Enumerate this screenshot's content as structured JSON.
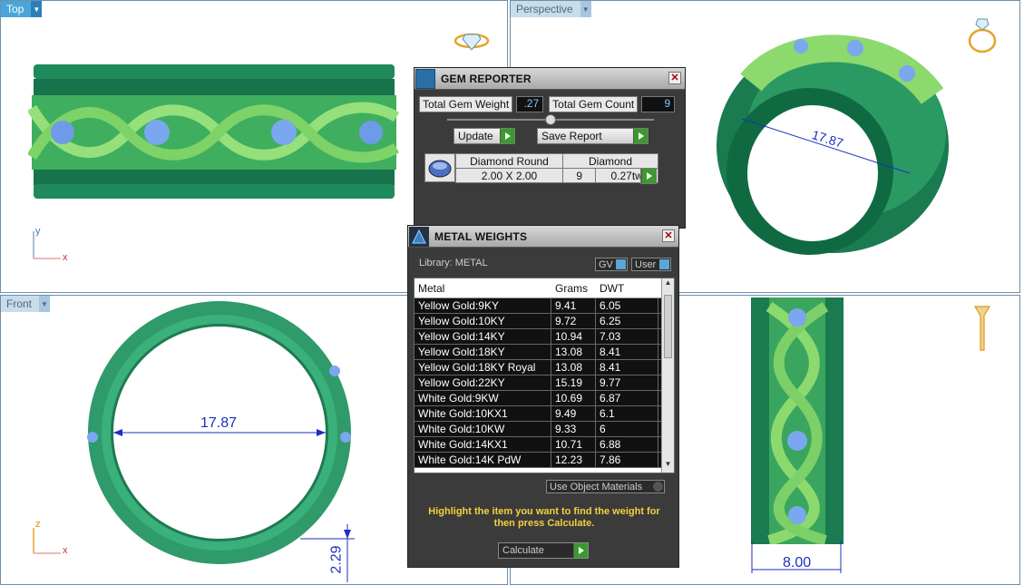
{
  "viewports": {
    "top": {
      "label": "Top",
      "axes": {
        "v": "y",
        "h": "x"
      }
    },
    "perspective": {
      "label": "Perspective",
      "dimension": "17.87"
    },
    "front": {
      "label": "Front",
      "axes": {
        "v": "z",
        "h": "x"
      },
      "dimension": "17.87",
      "height_dim": "2.29"
    },
    "right": {
      "width_dim": "8.00"
    }
  },
  "gem_reporter": {
    "title": "GEM REPORTER",
    "total_weight_label": "Total Gem Weight",
    "total_weight_value": ".27",
    "total_count_label": "Total Gem Count",
    "total_count_value": "9",
    "update_label": "Update",
    "save_report_label": "Save Report",
    "gem": {
      "shape": "Diamond Round",
      "type": "Diamond",
      "size": "2.00 X 2.00",
      "count": "9",
      "weight": "0.27tw"
    }
  },
  "metal_weights": {
    "title": "METAL WEIGHTS",
    "library_label": "Library: METAL",
    "gv_label": "GV",
    "user_label": "User",
    "columns": [
      "Metal",
      "Grams",
      "DWT"
    ],
    "rows": [
      [
        "Yellow Gold:9KY",
        "9.41",
        "6.05"
      ],
      [
        "Yellow Gold:10KY",
        "9.72",
        "6.25"
      ],
      [
        "Yellow Gold:14KY",
        "10.94",
        "7.03"
      ],
      [
        "Yellow Gold:18KY",
        "13.08",
        "8.41"
      ],
      [
        "Yellow Gold:18KY Royal",
        "13.08",
        "8.41"
      ],
      [
        "Yellow Gold:22KY",
        "15.19",
        "9.77"
      ],
      [
        "White Gold:9KW",
        "10.69",
        "6.87"
      ],
      [
        "White Gold:10KX1",
        "9.49",
        "6.1"
      ],
      [
        "White Gold:10KW",
        "9.33",
        "6"
      ],
      [
        "White Gold:14KX1",
        "10.71",
        "6.88"
      ],
      [
        "White Gold:14K PdW",
        "12.23",
        "7.86"
      ]
    ],
    "use_object_materials": "Use Object Materials",
    "hint": "Highlight the item you want to find the weight for then press Calculate.",
    "calculate_label": "Calculate"
  }
}
